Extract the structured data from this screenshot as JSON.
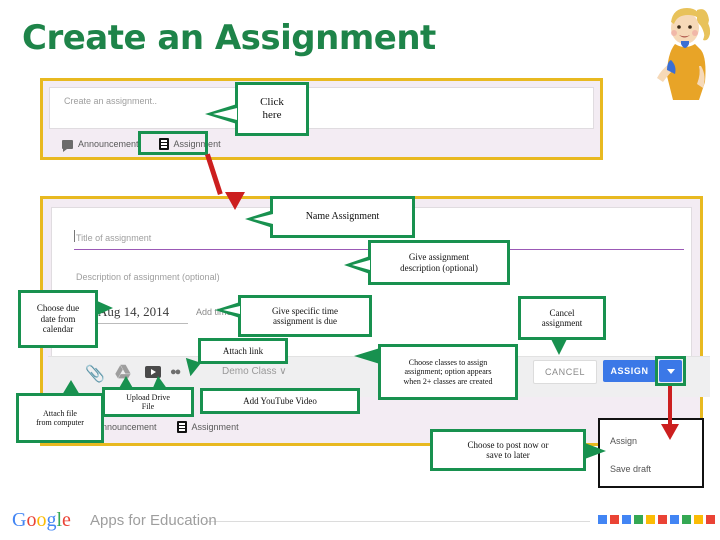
{
  "page": {
    "title": "Create an Assignment"
  },
  "screenshot_top": {
    "create_placeholder": "Create an assignment..",
    "type_announcement": "Announcement",
    "type_assignment": "Assignment"
  },
  "screenshot_bottom": {
    "title_placeholder": "Title of assignment",
    "description_placeholder": "Description of assignment (optional)",
    "due_date": "Aug 14, 2014",
    "add_time": "Add time",
    "class_selector": "Demo Class ∨",
    "cancel_button": "CANCEL",
    "assign_button": "ASSIGN",
    "type_announcement": "Announcement",
    "type_assignment": "Assignment",
    "dropdown": {
      "item_assign": "Assign",
      "item_save_draft": "Save draft"
    },
    "icons": {
      "attach_file": "paperclip-icon",
      "drive": "google-drive-icon",
      "youtube": "youtube-icon",
      "link": "link-icon",
      "dropdown_arrow": "chevron-down-icon"
    }
  },
  "callouts": {
    "click_here": "Click\nhere",
    "name_assignment": "Name Assignment",
    "give_description": "Give assignment\ndescription (optional)",
    "choose_due_date": "Choose due\ndate from\ncalendar",
    "give_specific_time": "Give specific time\nassignment is due",
    "cancel_assignment": "Cancel\nassignment",
    "attach_link": "Attach link",
    "attach_file": "Attach file\nfrom computer",
    "upload_drive_file": "Upload Drive\nFile",
    "add_youtube_video": "Add YouTube Video",
    "choose_classes": "Choose classes to assign\nassignment; option appears\nwhen 2+ classes are created",
    "post_now_or_save": "Choose to post now or\nsave to later"
  },
  "footer": {
    "google": "Google",
    "tagline": "Apps for Education",
    "swatch_colors": [
      "#4285f4",
      "#ea4335",
      "#4285f4",
      "#34a853",
      "#fbbc05",
      "#ea4335",
      "#4285f4",
      "#34a853",
      "#fbbc05",
      "#ea4335"
    ]
  },
  "theme": {
    "title_green": "#1e8449",
    "callout_green": "#18914f",
    "panel_border_gold": "#e8b920",
    "assign_blue": "#3b78e7",
    "arrow_red": "#cc1f1f"
  }
}
